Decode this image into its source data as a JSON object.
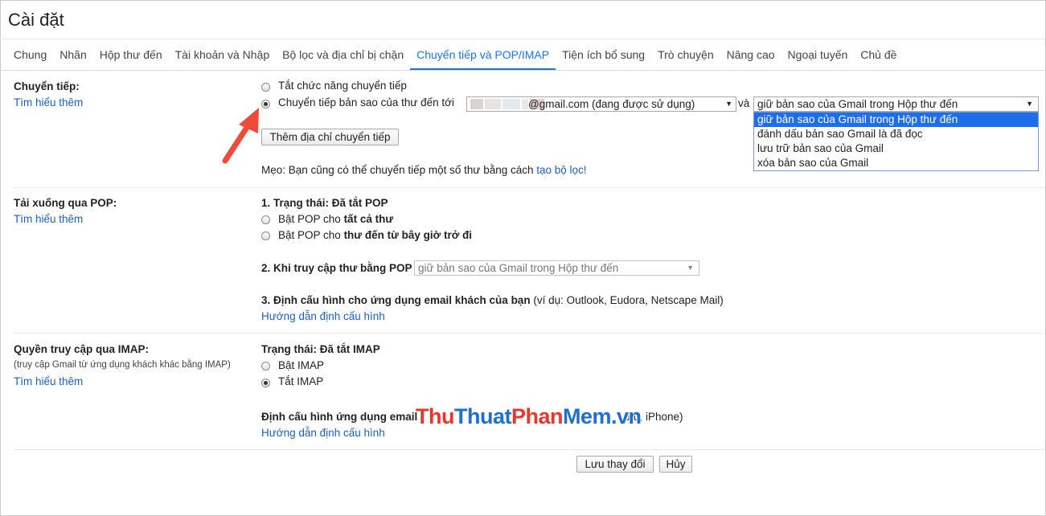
{
  "page_title": "Cài đặt",
  "tabs": [
    {
      "label": "Chung"
    },
    {
      "label": "Nhãn"
    },
    {
      "label": "Hộp thư đến"
    },
    {
      "label": "Tài khoản và Nhập"
    },
    {
      "label": "Bộ lọc và địa chỉ bị chặn"
    },
    {
      "label": "Chuyển tiếp và POP/IMAP"
    },
    {
      "label": "Tiện ích bổ sung"
    },
    {
      "label": "Trò chuyện"
    },
    {
      "label": "Nâng cao"
    },
    {
      "label": "Ngoại tuyến"
    },
    {
      "label": "Chủ đề"
    }
  ],
  "forwarding": {
    "label": "Chuyển tiếp:",
    "learn_more": "Tìm hiểu thêm",
    "option_disable": "Tắt chức năng chuyển tiếp",
    "option_forward": "Chuyển tiếp bản sao của thư đến tới",
    "email_suffix": "@gmail.com (đang được sử dụng)",
    "and": "và",
    "action_selected": "giữ bản sao của Gmail trong Hộp thư đến",
    "action_options": [
      "giữ bản sao của Gmail trong Hộp thư đến",
      "đánh dấu bản sao Gmail là đã đọc",
      "lưu trữ bản sao của Gmail",
      "xóa bản sao của Gmail"
    ],
    "add_button": "Thêm địa chỉ chuyển tiếp",
    "tip_text": "Mẹo: Bạn cũng có thể chuyển tiếp một số thư bằng cách",
    "tip_link": "tạo bộ lọc!"
  },
  "pop": {
    "label": "Tải xuống qua POP:",
    "learn_more": "Tìm hiểu thêm",
    "status": "1. Trạng thái: Đã tắt POP",
    "opt_all_prefix": "Bật POP cho",
    "opt_all_bold": "tất cả thư",
    "opt_new_prefix": "Bật POP cho",
    "opt_new_bold": "thư đến từ bây giờ trở đi",
    "access_label": "2. Khi truy cập thư bằng POP",
    "access_selected": "giữ bản sao của Gmail trong Hộp thư đến",
    "config_bold": "3. Định cấu hình cho ứng dụng email khách của bạn",
    "config_rest": "(ví dụ: Outlook, Eudora, Netscape Mail)",
    "config_link": "Hướng dẫn định cấu hình"
  },
  "imap": {
    "label": "Quyền truy cập qua IMAP:",
    "sublabel": "(truy cập Gmail từ ứng dụng khách khác bằng IMAP)",
    "learn_more": "Tìm hiểu thêm",
    "status": "Trạng thái: Đã tắt IMAP",
    "opt_enable": "Bật IMAP",
    "opt_disable": "Tắt IMAP",
    "config_bold": "Định cấu hình ứng dụng email",
    "config_rest": "ord, iPhone)",
    "config_link": "Hướng dẫn định cấu hình"
  },
  "footer": {
    "save": "Lưu thay đổi",
    "cancel": "Hủy"
  },
  "watermark": {
    "part_a": "Thu",
    "part_b": "Thuat",
    "part_c": "Phan",
    "part_d": "Mem",
    "part_e": ".vn"
  },
  "colors": {
    "accent": "#1a73e8",
    "link": "#1a5fc4",
    "arrow": "#f04a3a",
    "selection": "#1e6ee9"
  }
}
